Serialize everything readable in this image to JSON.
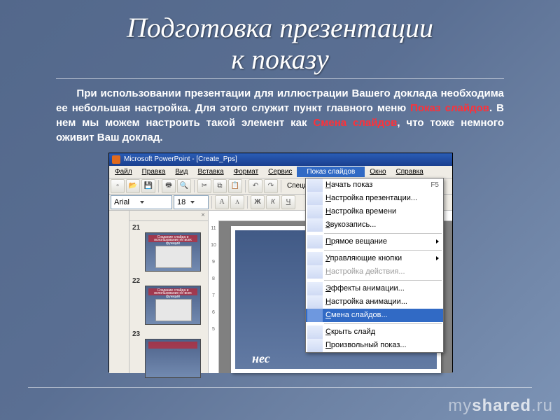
{
  "slide": {
    "title_line1": "Подготовка презентации",
    "title_line2": "к показу",
    "para_before": "При использовании презентации для иллюстрации Вашего доклада необходима ее небольшая настройка. Для этого служит пункт главного меню ",
    "accent1": "Показ слайдов",
    "para_mid": ". В нем мы можем настроить такой элемент как ",
    "accent2": "Смена слайдов",
    "para_after": ", что тоже немного оживит Ваш доклад."
  },
  "screenshot": {
    "window_title": "Microsoft PowerPoint - [Create_Pps]",
    "menubar": {
      "file": "Файл",
      "edit": "Правка",
      "view": "Вид",
      "insert": "Вставка",
      "format": "Формат",
      "service": "Сервис",
      "slideshow": "Показ слайдов",
      "window": "Окно",
      "help": "Справка"
    },
    "toolbar_special": "Специаль",
    "font_name": "Arial",
    "font_size": "18",
    "thumb_numbers": [
      "21",
      "22",
      "23"
    ],
    "thumb_caption": "Создание слайда и использование не всех функций",
    "page_caption": "нес",
    "dropdown": [
      {
        "label": "Начать показ",
        "shortcut": "F5",
        "icon": "play-icon"
      },
      {
        "label": "Настройка презентации...",
        "icon": "settings-icon"
      },
      {
        "label": "Настройка времени",
        "icon": "timer-icon"
      },
      {
        "label": "Звукозапись...",
        "icon": "mic-icon"
      },
      {
        "sep": true
      },
      {
        "label": "Прямое вещание",
        "submenu": true
      },
      {
        "sep": true
      },
      {
        "label": "Управляющие кнопки",
        "submenu": true
      },
      {
        "label": "Настройка действия...",
        "disabled": true
      },
      {
        "sep": true
      },
      {
        "label": "Эффекты анимации...",
        "icon": "sparkle-icon"
      },
      {
        "label": "Настройка анимации...",
        "icon": "anim-icon"
      },
      {
        "label": "Смена слайдов...",
        "icon": "transition-icon",
        "selected": true
      },
      {
        "sep": true
      },
      {
        "label": "Скрыть слайд",
        "icon": "hide-icon"
      },
      {
        "label": "Произвольный показ...",
        "icon": "custom-icon"
      }
    ]
  },
  "watermark": {
    "a": "my",
    "b": "shared",
    "c": ".ru"
  }
}
